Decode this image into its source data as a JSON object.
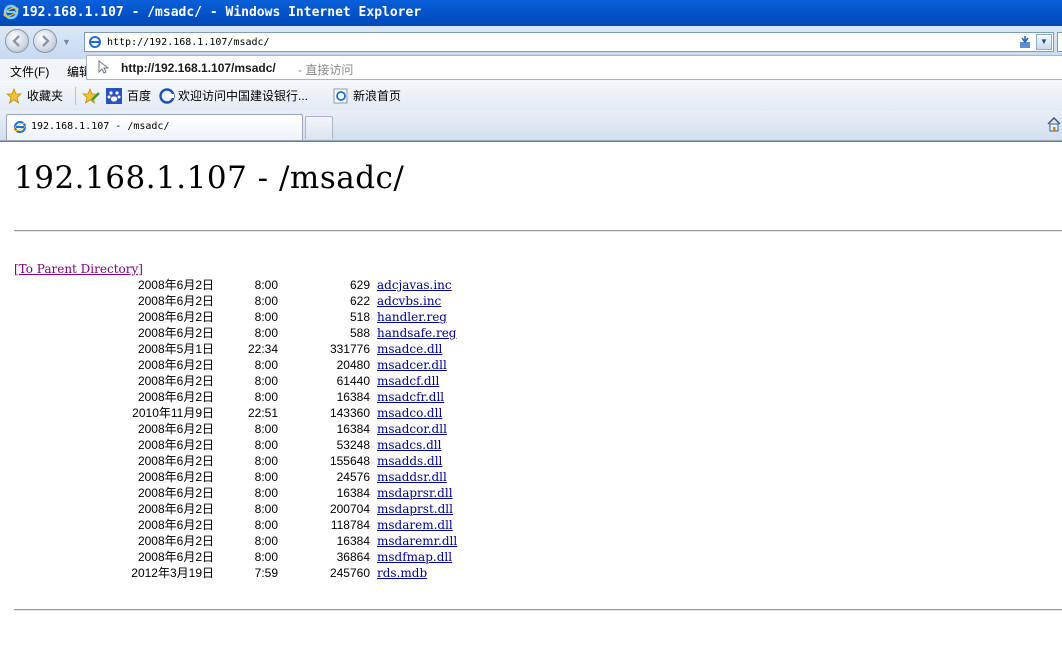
{
  "window": {
    "title": "192.168.1.107 - /msadc/ - Windows Internet Explorer"
  },
  "navigation": {
    "address_url": "http://192.168.1.107/msadc/"
  },
  "menu": {
    "file": "文件(F)",
    "edit": "编辑"
  },
  "autocomplete": {
    "url": "http://192.168.1.107/msadc/",
    "hint": "- 直接访问"
  },
  "favorites": {
    "favorites_label": "收藏夹",
    "items": [
      {
        "label": "百度"
      },
      {
        "label": "欢迎访问中国建设银行..."
      },
      {
        "label": "新浪首页"
      }
    ]
  },
  "tabs": [
    {
      "label": "192.168.1.107 - /msadc/"
    }
  ],
  "page": {
    "heading": "192.168.1.107 - /msadc/",
    "parent_link": "[To Parent Directory]",
    "files": [
      {
        "date": "2008年6月2日",
        "time": "8:00",
        "size": "629",
        "name": "adcjavas.inc"
      },
      {
        "date": "2008年6月2日",
        "time": "8:00",
        "size": "622",
        "name": "adcvbs.inc"
      },
      {
        "date": "2008年6月2日",
        "time": "8:00",
        "size": "518",
        "name": "handler.reg"
      },
      {
        "date": "2008年6月2日",
        "time": "8:00",
        "size": "588",
        "name": "handsafe.reg"
      },
      {
        "date": "2008年5月1日",
        "time": "22:34",
        "size": "331776",
        "name": "msadce.dll"
      },
      {
        "date": "2008年6月2日",
        "time": "8:00",
        "size": "20480",
        "name": "msadcer.dll"
      },
      {
        "date": "2008年6月2日",
        "time": "8:00",
        "size": "61440",
        "name": "msadcf.dll"
      },
      {
        "date": "2008年6月2日",
        "time": "8:00",
        "size": "16384",
        "name": "msadcfr.dll"
      },
      {
        "date": "2010年11月9日",
        "time": "22:51",
        "size": "143360",
        "name": "msadco.dll"
      },
      {
        "date": "2008年6月2日",
        "time": "8:00",
        "size": "16384",
        "name": "msadcor.dll"
      },
      {
        "date": "2008年6月2日",
        "time": "8:00",
        "size": "53248",
        "name": "msadcs.dll"
      },
      {
        "date": "2008年6月2日",
        "time": "8:00",
        "size": "155648",
        "name": "msadds.dll"
      },
      {
        "date": "2008年6月2日",
        "time": "8:00",
        "size": "24576",
        "name": "msaddsr.dll"
      },
      {
        "date": "2008年6月2日",
        "time": "8:00",
        "size": "16384",
        "name": "msdaprsr.dll"
      },
      {
        "date": "2008年6月2日",
        "time": "8:00",
        "size": "200704",
        "name": "msdaprst.dll"
      },
      {
        "date": "2008年6月2日",
        "time": "8:00",
        "size": "118784",
        "name": "msdarem.dll"
      },
      {
        "date": "2008年6月2日",
        "time": "8:00",
        "size": "16384",
        "name": "msdaremr.dll"
      },
      {
        "date": "2008年6月2日",
        "time": "8:00",
        "size": "36864",
        "name": "msdfmap.dll"
      },
      {
        "date": "2012年3月19日",
        "time": "7:59",
        "size": "245760",
        "name": "rds.mdb"
      }
    ]
  },
  "colors": {
    "title_bar": "#0250c6",
    "link": "#00008b",
    "visited_link": "#800080"
  }
}
